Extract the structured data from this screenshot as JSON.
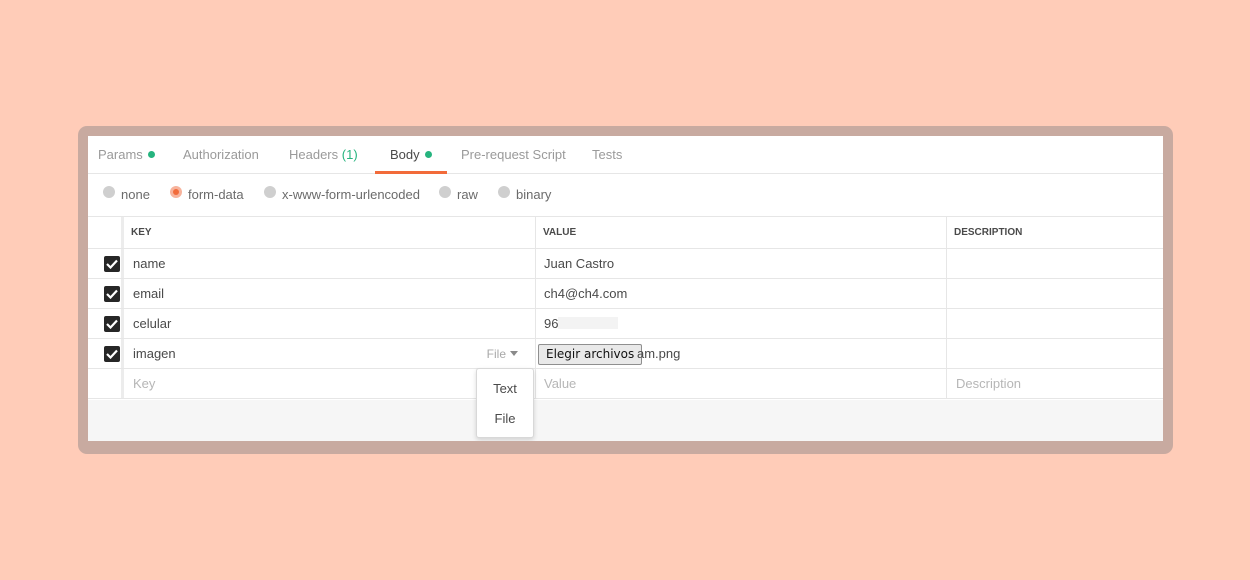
{
  "tabs": [
    {
      "label": "Params",
      "dot": true
    },
    {
      "label": "Authorization"
    },
    {
      "label": "Headers",
      "count": "(1)"
    },
    {
      "label": "Body",
      "dot": true,
      "active": true
    },
    {
      "label": "Pre-request Script"
    },
    {
      "label": "Tests"
    }
  ],
  "body_types": [
    {
      "label": "none"
    },
    {
      "label": "form-data",
      "selected": true
    },
    {
      "label": "x-www-form-urlencoded"
    },
    {
      "label": "raw"
    },
    {
      "label": "binary"
    }
  ],
  "table": {
    "headers": {
      "key": "KEY",
      "value": "VALUE",
      "description": "DESCRIPTION"
    },
    "rows": [
      {
        "checked": true,
        "key": "name",
        "value": "Juan Castro",
        "description": ""
      },
      {
        "checked": true,
        "key": "email",
        "value": "ch4@ch4.com",
        "description": ""
      },
      {
        "checked": true,
        "key": "celular",
        "value": "96",
        "description": ""
      },
      {
        "checked": true,
        "key": "imagen",
        "type_label": "File",
        "file_button": "Elegir archivos",
        "file_name": "am.png",
        "description": ""
      }
    ],
    "new_row": {
      "key_placeholder": "Key",
      "value_placeholder": "Value",
      "description_placeholder": "Description"
    }
  },
  "type_menu": {
    "options": [
      "Text",
      "File"
    ]
  },
  "colors": {
    "background": "#ffccb8",
    "accent": "#f26b3a",
    "status_dot": "#26b47f"
  }
}
